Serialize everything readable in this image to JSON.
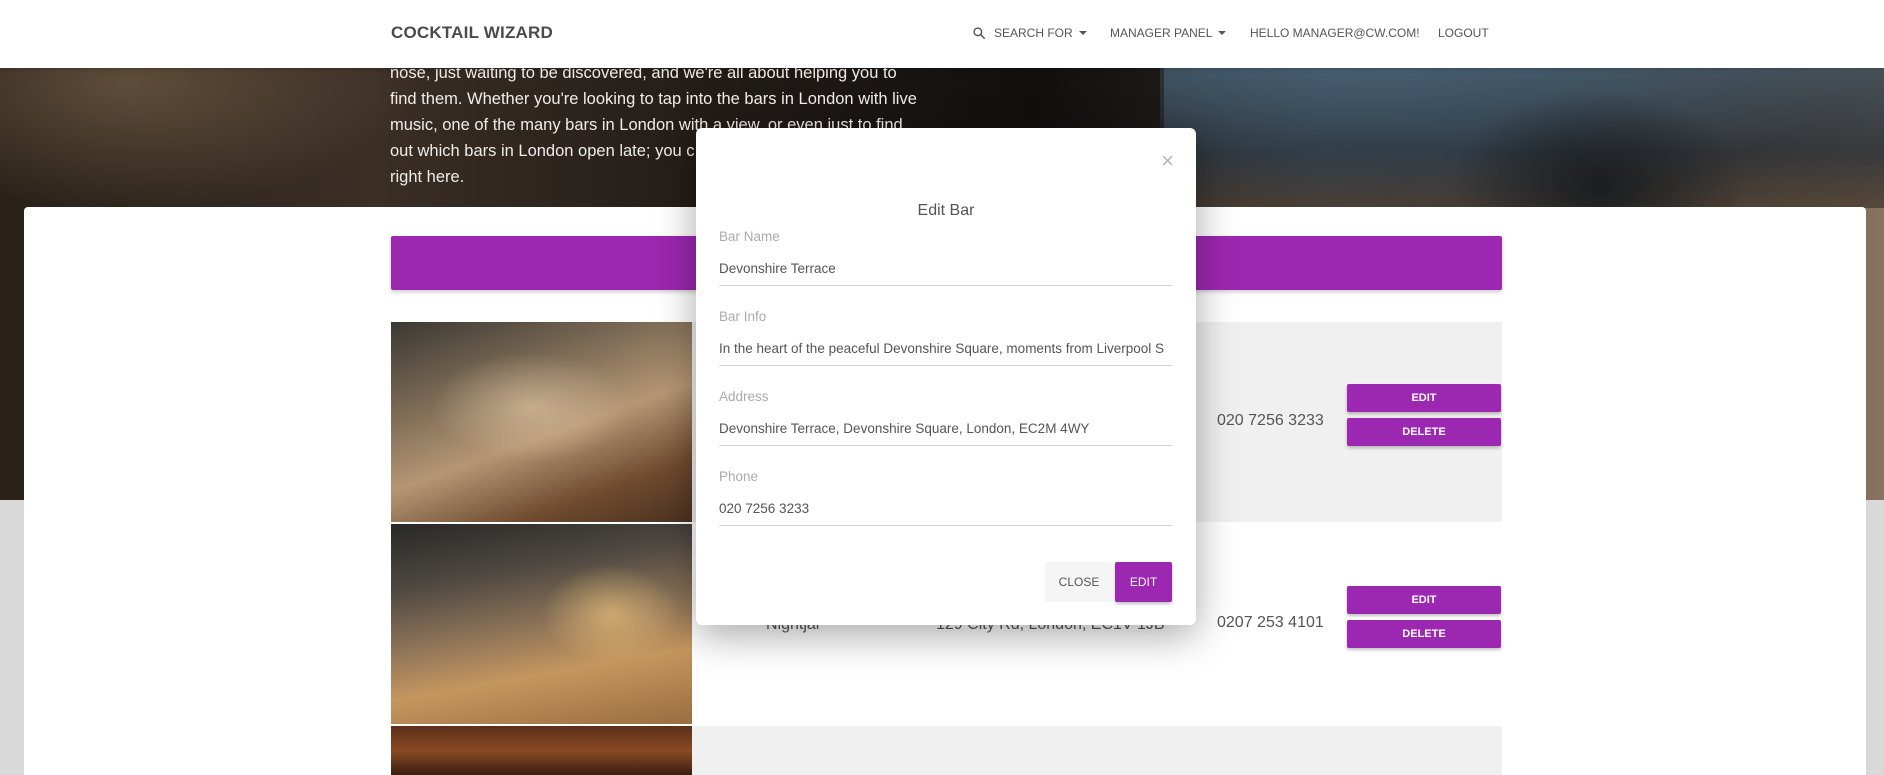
{
  "nav": {
    "brand": "COCKTAIL WIZARD",
    "search_label": "SEARCH FOR",
    "manager_label": "MANAGER PANEL",
    "greeting": "HELLO MANAGER@CW.COM!",
    "logout": "LOGOUT"
  },
  "hero": {
    "lines": [
      "nose, just waiting to be discovered, and we're all about helping you to",
      "find them. Whether you're looking to tap into the bars in London with live",
      "music, one of the many bars in London with a view, or even just to find",
      "out which bars in London open late; you c",
      "right here."
    ]
  },
  "bars": [
    {
      "name": "",
      "address": "",
      "phone": "020 7256 3233",
      "edit": "EDIT",
      "delete": "DELETE"
    },
    {
      "name": "Nightjar",
      "address": "129 City Rd, London, EC1V 1JB",
      "phone": "0207 253 4101",
      "edit": "EDIT",
      "delete": "DELETE"
    }
  ],
  "modal": {
    "title": "Edit Bar",
    "close_icon": "×",
    "fields": [
      {
        "label": "Bar Name",
        "value": "Devonshire Terrace"
      },
      {
        "label": "Bar Info",
        "value": "In the heart of the peaceful Devonshire Square, moments from Liverpool S"
      },
      {
        "label": "Address",
        "value": "Devonshire Terrace, Devonshire Square, London, EC2M 4WY"
      },
      {
        "label": "Phone",
        "value": "020 7256 3233"
      }
    ],
    "close_button": "CLOSE",
    "edit_button": "EDIT"
  },
  "colors": {
    "accent": "#9c27b0",
    "navbar": "#ffffff"
  }
}
